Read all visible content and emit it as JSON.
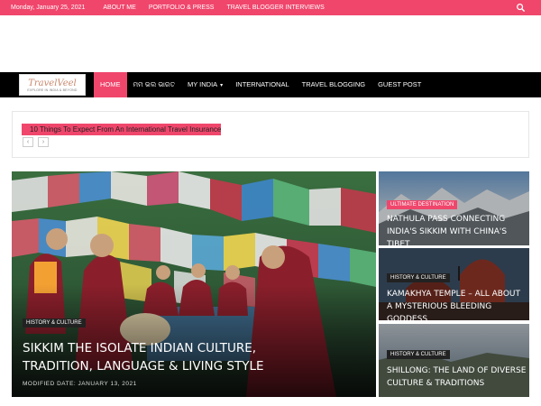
{
  "topbar": {
    "date": "Monday, January 25, 2021",
    "links": [
      "ABOUT ME",
      "PORTFOLIO & PRESS",
      "TRAVEL BLOGGER INTERVIEWS"
    ]
  },
  "logo": {
    "script": "TravelVeel",
    "tagline": "EXPLORE IN INDIA & BEYOND"
  },
  "nav": {
    "items": [
      "HOME",
      "ମମ ଭଲ ଭାରତ",
      "MY INDIA",
      "INTERNATIONAL",
      "TRAVEL BLOGGING",
      "GUEST POST"
    ]
  },
  "ticker": {
    "headline": "10 Things To Expect From An International Travel Insurance"
  },
  "featured": {
    "category": "HISTORY & CULTURE",
    "title": "SIKKIM THE ISOLATE INDIAN CULTURE, TRADITION, LANGUAGE & LIVING STYLE",
    "meta": "MODIFIED DATE: JANUARY 13, 2021"
  },
  "side": [
    {
      "category": "ULTIMATE DESTINATION",
      "title": "NATHULA PASS CONNECTING INDIA'S SIKKIM WITH CHINA'S TIBET"
    },
    {
      "category": "HISTORY & CULTURE",
      "title": "KAMAKHYA TEMPLE – ALL ABOUT A MYSTERIOUS BLEEDING GODDESS"
    },
    {
      "category": "HISTORY & CULTURE",
      "title": "SHILLONG: THE LAND OF DIVERSE CULTURE & TRADITIONS"
    }
  ],
  "colors": {
    "accent": "#f0466c",
    "nav_bg": "#000000"
  }
}
